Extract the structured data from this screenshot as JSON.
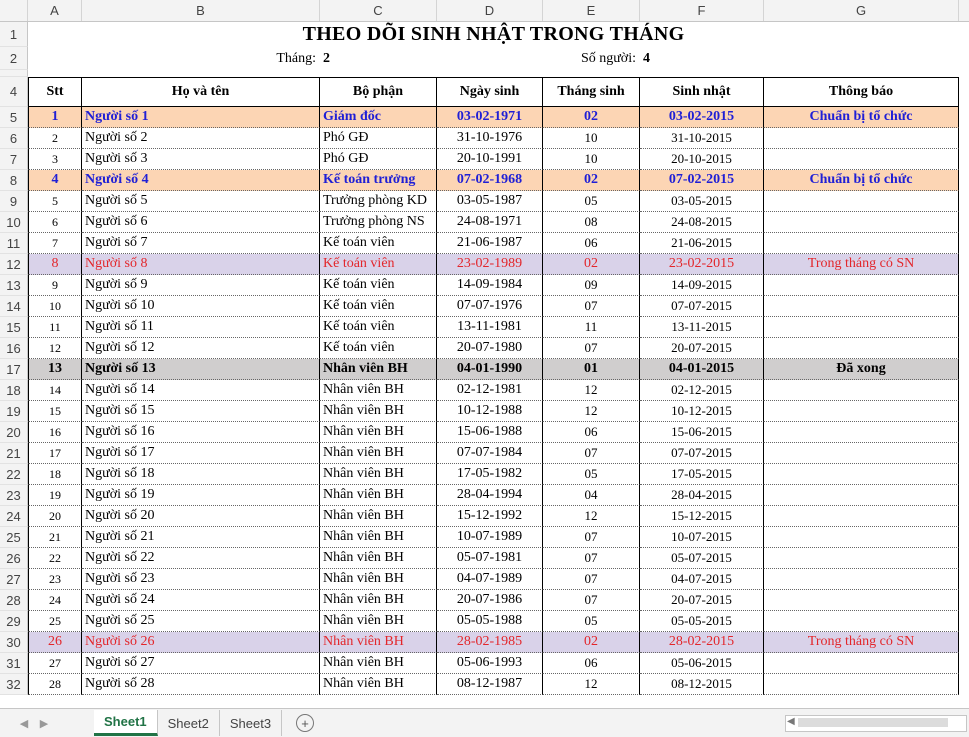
{
  "columns": [
    "A",
    "B",
    "C",
    "D",
    "E",
    "F",
    "G"
  ],
  "title": "THEO DÕI SINH NHẬT TRONG THÁNG",
  "month_label": "Tháng:",
  "month_value": "2",
  "count_label": "Số người:",
  "count_value": "4",
  "headers": [
    "Stt",
    "Họ và tên",
    "Bộ phận",
    "Ngày sinh",
    "Tháng sinh",
    "Sinh nhật",
    "Thông báo"
  ],
  "row_numbers": [
    "1",
    "2",
    "3",
    "4"
  ],
  "rows": [
    {
      "r": "5",
      "stt": "1",
      "name": "Người số 1",
      "dept": "Giám đốc",
      "dob": "03-02-1971",
      "month": "02",
      "bday": "03-02-2015",
      "note": "Chuẩn bị tổ chức",
      "style": "boss"
    },
    {
      "r": "6",
      "stt": "2",
      "name": "Người số 2",
      "dept": "Phó GĐ",
      "dob": "31-10-1976",
      "month": "10",
      "bday": "31-10-2015",
      "note": "",
      "style": ""
    },
    {
      "r": "7",
      "stt": "3",
      "name": "Người số 3",
      "dept": "Phó GĐ",
      "dob": "20-10-1991",
      "month": "10",
      "bday": "20-10-2015",
      "note": "",
      "style": ""
    },
    {
      "r": "8",
      "stt": "4",
      "name": "Người số 4",
      "dept": "Kế toán trưởng",
      "dob": "07-02-1968",
      "month": "02",
      "bday": "07-02-2015",
      "note": "Chuẩn bị tổ chức",
      "style": "boss"
    },
    {
      "r": "9",
      "stt": "5",
      "name": "Người số 5",
      "dept": "Trưởng phòng KD",
      "dob": "03-05-1987",
      "month": "05",
      "bday": "03-05-2015",
      "note": "",
      "style": ""
    },
    {
      "r": "10",
      "stt": "6",
      "name": "Người số 6",
      "dept": "Trưởng phòng NS",
      "dob": "24-08-1971",
      "month": "08",
      "bday": "24-08-2015",
      "note": "",
      "style": ""
    },
    {
      "r": "11",
      "stt": "7",
      "name": "Người số 7",
      "dept": "Kế toán viên",
      "dob": "21-06-1987",
      "month": "06",
      "bday": "21-06-2015",
      "note": "",
      "style": ""
    },
    {
      "r": "12",
      "stt": "8",
      "name": "Người số 8",
      "dept": "Kế toán viên",
      "dob": "23-02-1989",
      "month": "02",
      "bday": "23-02-2015",
      "note": "Trong tháng có SN",
      "style": "sn"
    },
    {
      "r": "13",
      "stt": "9",
      "name": "Người số 9",
      "dept": "Kế toán viên",
      "dob": "14-09-1984",
      "month": "09",
      "bday": "14-09-2015",
      "note": "",
      "style": ""
    },
    {
      "r": "14",
      "stt": "10",
      "name": "Người số 10",
      "dept": "Kế toán viên",
      "dob": "07-07-1976",
      "month": "07",
      "bday": "07-07-2015",
      "note": "",
      "style": ""
    },
    {
      "r": "15",
      "stt": "11",
      "name": "Người số 11",
      "dept": "Kế toán viên",
      "dob": "13-11-1981",
      "month": "11",
      "bday": "13-11-2015",
      "note": "",
      "style": ""
    },
    {
      "r": "16",
      "stt": "12",
      "name": "Người số 12",
      "dept": "Kế toán viên",
      "dob": "20-07-1980",
      "month": "07",
      "bday": "20-07-2015",
      "note": "",
      "style": ""
    },
    {
      "r": "17",
      "stt": "13",
      "name": "Người số 13",
      "dept": "Nhân viên BH",
      "dob": "04-01-1990",
      "month": "01",
      "bday": "04-01-2015",
      "note": "Đã xong",
      "style": "done"
    },
    {
      "r": "18",
      "stt": "14",
      "name": "Người số 14",
      "dept": "Nhân viên BH",
      "dob": "02-12-1981",
      "month": "12",
      "bday": "02-12-2015",
      "note": "",
      "style": ""
    },
    {
      "r": "19",
      "stt": "15",
      "name": "Người số 15",
      "dept": "Nhân viên BH",
      "dob": "10-12-1988",
      "month": "12",
      "bday": "10-12-2015",
      "note": "",
      "style": ""
    },
    {
      "r": "20",
      "stt": "16",
      "name": "Người số 16",
      "dept": "Nhân viên BH",
      "dob": "15-06-1988",
      "month": "06",
      "bday": "15-06-2015",
      "note": "",
      "style": ""
    },
    {
      "r": "21",
      "stt": "17",
      "name": "Người số 17",
      "dept": "Nhân viên BH",
      "dob": "07-07-1984",
      "month": "07",
      "bday": "07-07-2015",
      "note": "",
      "style": ""
    },
    {
      "r": "22",
      "stt": "18",
      "name": "Người số 18",
      "dept": "Nhân viên BH",
      "dob": "17-05-1982",
      "month": "05",
      "bday": "17-05-2015",
      "note": "",
      "style": ""
    },
    {
      "r": "23",
      "stt": "19",
      "name": "Người số 19",
      "dept": "Nhân viên BH",
      "dob": "28-04-1994",
      "month": "04",
      "bday": "28-04-2015",
      "note": "",
      "style": ""
    },
    {
      "r": "24",
      "stt": "20",
      "name": "Người số 20",
      "dept": "Nhân viên BH",
      "dob": "15-12-1992",
      "month": "12",
      "bday": "15-12-2015",
      "note": "",
      "style": ""
    },
    {
      "r": "25",
      "stt": "21",
      "name": "Người số 21",
      "dept": "Nhân viên BH",
      "dob": "10-07-1989",
      "month": "07",
      "bday": "10-07-2015",
      "note": "",
      "style": ""
    },
    {
      "r": "26",
      "stt": "22",
      "name": "Người số 22",
      "dept": "Nhân viên BH",
      "dob": "05-07-1981",
      "month": "07",
      "bday": "05-07-2015",
      "note": "",
      "style": ""
    },
    {
      "r": "27",
      "stt": "23",
      "name": "Người số 23",
      "dept": "Nhân viên BH",
      "dob": "04-07-1989",
      "month": "07",
      "bday": "04-07-2015",
      "note": "",
      "style": ""
    },
    {
      "r": "28",
      "stt": "24",
      "name": "Người số 24",
      "dept": "Nhân viên BH",
      "dob": "20-07-1986",
      "month": "07",
      "bday": "20-07-2015",
      "note": "",
      "style": ""
    },
    {
      "r": "29",
      "stt": "25",
      "name": "Người số 25",
      "dept": "Nhân viên BH",
      "dob": "05-05-1988",
      "month": "05",
      "bday": "05-05-2015",
      "note": "",
      "style": ""
    },
    {
      "r": "30",
      "stt": "26",
      "name": "Người số 26",
      "dept": "Nhân viên BH",
      "dob": "28-02-1985",
      "month": "02",
      "bday": "28-02-2015",
      "note": "Trong tháng có SN",
      "style": "sn"
    },
    {
      "r": "31",
      "stt": "27",
      "name": "Người số 27",
      "dept": "Nhân viên BH",
      "dob": "05-06-1993",
      "month": "06",
      "bday": "05-06-2015",
      "note": "",
      "style": ""
    },
    {
      "r": "32",
      "stt": "28",
      "name": "Người số 28",
      "dept": "Nhân viên BH",
      "dob": "08-12-1987",
      "month": "12",
      "bday": "08-12-2015",
      "note": "",
      "style": ""
    }
  ],
  "sheet_tabs": [
    "Sheet1",
    "Sheet2",
    "Sheet3"
  ],
  "active_sheet": "Sheet1"
}
